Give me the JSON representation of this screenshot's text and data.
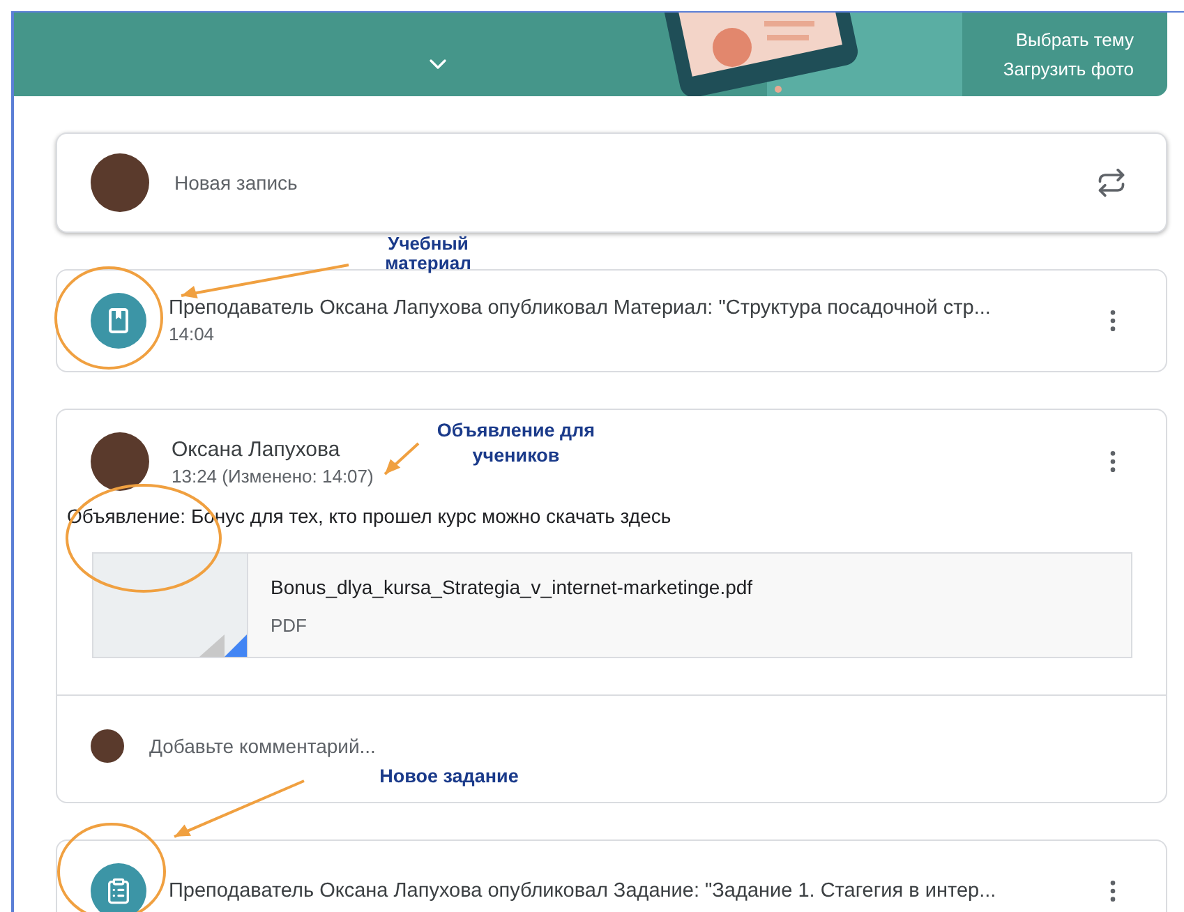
{
  "banner": {
    "links": [
      "Выбрать тему",
      "Загрузить фото"
    ]
  },
  "new_post": {
    "placeholder": "Новая запись"
  },
  "stream": [
    {
      "kind": "material",
      "text": "Преподаватель Оксана Лапухова опубликовал Материал: \"Структура посадочной стр...",
      "time": "14:04"
    },
    {
      "kind": "announcement",
      "author": "Оксана Лапухова",
      "time": "13:24 (Изменено: 14:07)",
      "text": "Объявление: Бонус для тех, кто прошел курс можно скачать здесь",
      "attachment": {
        "name": "Bonus_dlya_kursa_Strategia_v_internet-marketinge.pdf",
        "type": "PDF"
      },
      "comment_placeholder": "Добавьте комментарий..."
    },
    {
      "kind": "assignment",
      "text": "Преподаватель Оксана Лапухова опубликовал Задание: \"Задание 1. Стагегия в интер..."
    }
  ],
  "annotations": [
    {
      "text": "Учебный материал"
    },
    {
      "text": "Объявление для учеников"
    },
    {
      "text": "Новое задание"
    }
  ]
}
